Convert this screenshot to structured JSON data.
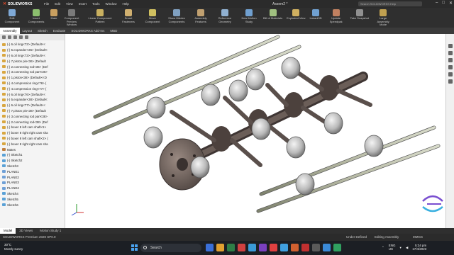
{
  "titlebar": {
    "brand": "SOLIDWORKS",
    "menu": [
      "File",
      "Edit",
      "View",
      "Insert",
      "Tools",
      "Window",
      "Help"
    ],
    "document_title": "Assem2 *",
    "search_placeholder": "Search SOLIDWORKS Help"
  },
  "ribbon": [
    {
      "label": "Edit Component",
      "color": "#7fa9d6"
    },
    {
      "label": "Insert Components",
      "color": "#8cbf6e"
    },
    {
      "label": "Mate",
      "color": "#c9a060"
    },
    {
      "label": "Component Preview Window",
      "color": "#7a7a7a"
    },
    {
      "label": "Linear Component Pattern",
      "color": "#c9b060"
    },
    {
      "label": "Smart Fasteners",
      "color": "#d0b070"
    },
    {
      "label": "Move Component",
      "color": "#d0c060"
    },
    {
      "label": "Show Hidden Components",
      "color": "#80a0c0"
    },
    {
      "label": "Assembly Features",
      "color": "#c0a070"
    },
    {
      "label": "Reference Geometry",
      "color": "#90b0d0"
    },
    {
      "label": "New Motion Study",
      "color": "#70a0d0"
    },
    {
      "label": "Bill of Materials",
      "color": "#a0c080"
    },
    {
      "label": "Exploded View",
      "color": "#d0b060"
    },
    {
      "label": "Instant3D",
      "color": "#70a0d0"
    },
    {
      "label": "Update Speedpak",
      "color": "#c08060"
    },
    {
      "label": "Take Snapshot",
      "color": "#909090"
    },
    {
      "label": "Large Assembly Mode",
      "color": "#c0a050"
    }
  ],
  "tabs": [
    "Assembly",
    "Layout",
    "Sketch",
    "Evaluate",
    "SOLIDWORKS Add-Ins",
    "MBD"
  ],
  "tree": [
    {
      "label": "(-) 6.oil ring<72> (Default<<",
      "kind": "part"
    },
    {
      "label": "(-) 5.expander<36> (Default<",
      "kind": "part"
    },
    {
      "label": "(-) 6.oil ring<73> (Default<<",
      "kind": "part"
    },
    {
      "label": "(-) 7.piston pin<36> (Default",
      "kind": "part"
    },
    {
      "label": "(-) 2.connecting rod<36> (Def",
      "kind": "part"
    },
    {
      "label": "(-) 3.connecting rod part<36>",
      "kind": "part"
    },
    {
      "label": "(-) 1.piston<38> (Default<<D",
      "kind": "part"
    },
    {
      "label": "(-) 4.compression ring<76> (",
      "kind": "part"
    },
    {
      "label": "(-) 4.compression ring<77> (",
      "kind": "part"
    },
    {
      "label": "(-) 6.oil ring<76> (Default<<",
      "kind": "part"
    },
    {
      "label": "(-) 5.expander<38> (Default<",
      "kind": "part"
    },
    {
      "label": "(-) 6.oil ring<77> (Default<<",
      "kind": "part"
    },
    {
      "label": "(-) 7.piston pin<38> (Default",
      "kind": "part"
    },
    {
      "label": "(-) 3.connecting rod part<38>",
      "kind": "part"
    },
    {
      "label": "(-) 2.connecting rod<38> (Def",
      "kind": "part"
    },
    {
      "label": "(-) boxer 8 left cam shaft<1>",
      "kind": "part"
    },
    {
      "label": "(-) boxer 8 right right cam sha",
      "kind": "part"
    },
    {
      "label": "(-) boxer 8 left cam shaft<2> (",
      "kind": "part"
    },
    {
      "label": "(-) boxer 8 right right cam sha",
      "kind": "part"
    },
    {
      "label": "Mates",
      "kind": "mate"
    },
    {
      "label": "(-) Sketch1",
      "kind": "sketch"
    },
    {
      "label": "(-) Sketch2",
      "kind": "sketch"
    },
    {
      "label": "Sketch3",
      "kind": "sketch"
    },
    {
      "label": "PLANE1",
      "kind": "plane"
    },
    {
      "label": "PLANE2",
      "kind": "plane"
    },
    {
      "label": "PLANE3",
      "kind": "plane"
    },
    {
      "label": "PLANE4",
      "kind": "plane"
    },
    {
      "label": "Sketch4",
      "kind": "sketch"
    },
    {
      "label": "Sketch5",
      "kind": "sketch"
    },
    {
      "label": "Sketch6",
      "kind": "sketch"
    }
  ],
  "bottom_tabs": [
    "Model",
    "3D Views",
    "Motion Study 1"
  ],
  "status": {
    "left": "SOLIDWORKS Premium 2020 SP0.0",
    "under_defined": "Under Defined",
    "editing": "Editing Assembly",
    "units": "MMGS"
  },
  "taskbar": {
    "temperature": "30°C",
    "weather": "Mostly sunny",
    "search_label": "Search",
    "lang": "ENG",
    "region": "US",
    "time": "5:24 pm",
    "date": "17/4/2023"
  },
  "app_icon_colors": [
    "#3a6fd8",
    "#e0a030",
    "#2d7d46",
    "#d04040",
    "#3a9ad8",
    "#7a40c0",
    "#e04040",
    "#40a0e0",
    "#d06030",
    "#c03030",
    "#5a5a5a",
    "#3a8ad8",
    "#30a060"
  ]
}
